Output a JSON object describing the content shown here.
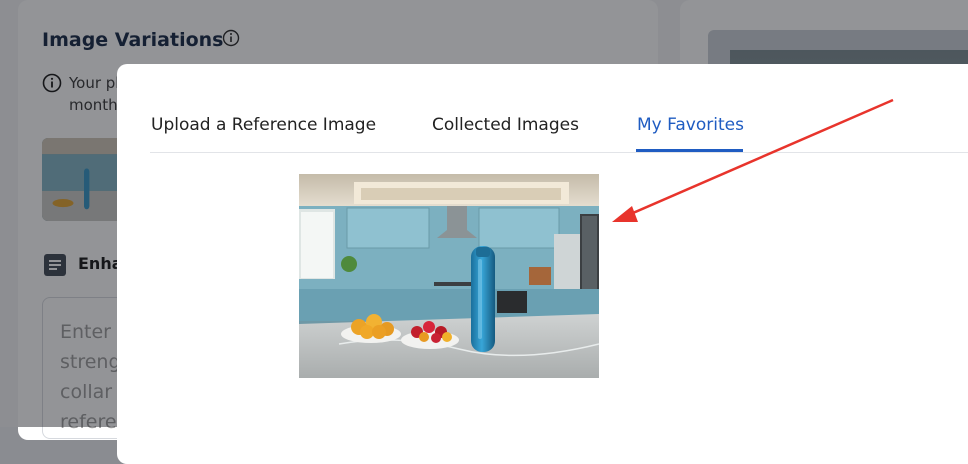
{
  "background": {
    "title": "Image Variations",
    "notice_line1": "Your pl",
    "notice_line2": "month",
    "enhance_label": "Enha",
    "placeholder_lines": [
      "Enter d",
      "streng",
      "collar",
      "refere"
    ]
  },
  "modal": {
    "tabs": [
      {
        "label": "Upload a Reference Image"
      },
      {
        "label": "Collected Images"
      },
      {
        "label": "My Favorites"
      }
    ],
    "active_tab": "My Favorites"
  },
  "icons": {
    "info": "info-icon",
    "notice": "info-circle-icon",
    "enhance": "list-icon"
  },
  "colors": {
    "accent": "#1f5cc2",
    "annotation_arrow": "#e8342c"
  }
}
